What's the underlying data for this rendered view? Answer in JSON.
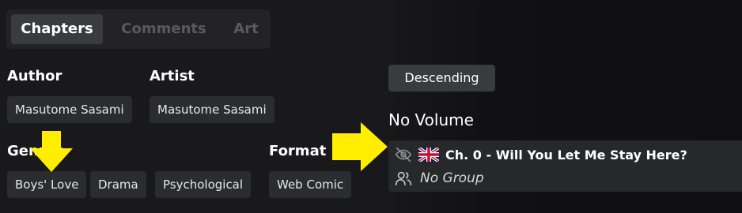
{
  "tabs": [
    {
      "label": "Chapters",
      "active": true
    },
    {
      "label": "Comments",
      "active": false
    },
    {
      "label": "Art",
      "active": false
    }
  ],
  "info": {
    "author_heading": "Author",
    "author_value": "Masutome Sasami",
    "artist_heading": "Artist",
    "artist_value": "Masutome Sasami",
    "genres_heading": "Genres",
    "genres": [
      "Boys' Love",
      "Drama",
      "Psychological"
    ],
    "format_heading": "Format",
    "format_value": "Web Comic"
  },
  "sort_button": "Descending",
  "volume_label": "No Volume",
  "chapter": {
    "title": "Ch. 0 - Will You Let Me Stay Here?",
    "group": "No Group",
    "flag_icon": "uk-flag-icon",
    "read_icon": "eye-off-icon",
    "group_icon": "users-icon"
  },
  "colors": {
    "background": "#19191b",
    "card": "#27282a",
    "chip": "#2b2c2f",
    "accent_arrow": "#ffee00"
  }
}
